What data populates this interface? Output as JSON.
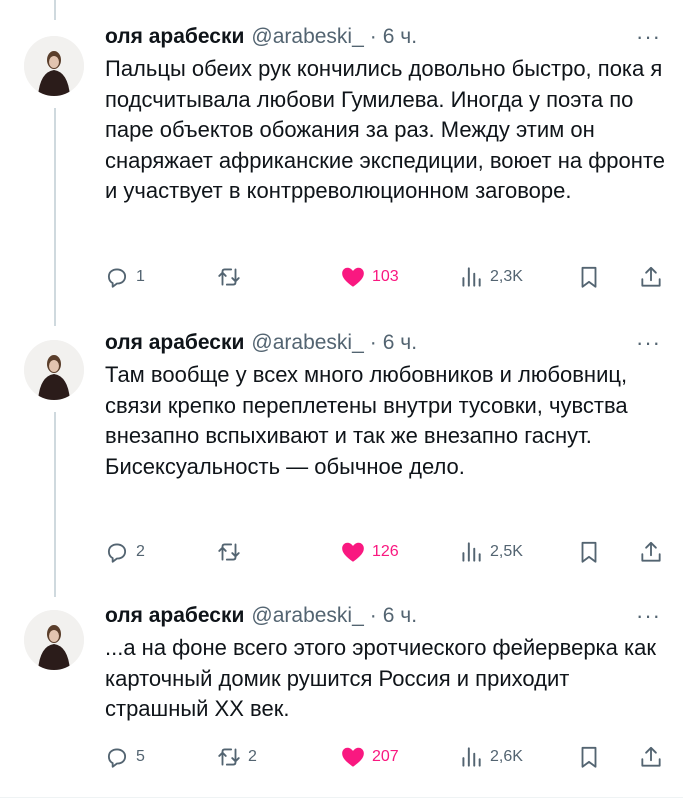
{
  "tweets": [
    {
      "name": "оля арабески",
      "handle": "@arabeski_",
      "sep": "·",
      "time": "6 ч.",
      "more": "···",
      "text": "Пальцы обеих рук кончились довольно быстро, пока я подсчитывала любови Гумилева. Иногда у поэта по паре объектов обожания за раз. Между этим он снаряжает африканские экспедиции, воюет на фронте и участвует в контрреволюционном заговоре.",
      "replies": "1",
      "reposts": "",
      "likes": "103",
      "views": "2,3K"
    },
    {
      "name": "оля арабески",
      "handle": "@arabeski_",
      "sep": "·",
      "time": "6 ч.",
      "more": "···",
      "text": "Там вообще у всех много любовников и любовниц, связи крепко переплетены внутри тусовки, чувства внезапно вспыхивают и так же внезапно гаснут. Бисексуальность — обычное дело.",
      "replies": "2",
      "reposts": "",
      "likes": "126",
      "views": "2,5K"
    },
    {
      "name": "оля арабески",
      "handle": "@arabeski_",
      "sep": "·",
      "time": "6 ч.",
      "more": "···",
      "text": "...а на фоне всего этого эротчиеского фейерверка как карточный домик рушится Россия и приходит страшный ХХ век.",
      "replies": "5",
      "reposts": "2",
      "likes": "207",
      "views": "2,6K"
    }
  ],
  "icons": {
    "reply": "reply-icon",
    "repost": "repost-icon",
    "like": "heart-icon",
    "views": "views-icon",
    "bookmark": "bookmark-icon",
    "share": "share-icon"
  },
  "colors": {
    "text": "#0f1419",
    "muted": "#536471",
    "like": "#f91880",
    "thread": "#cfd9de"
  }
}
